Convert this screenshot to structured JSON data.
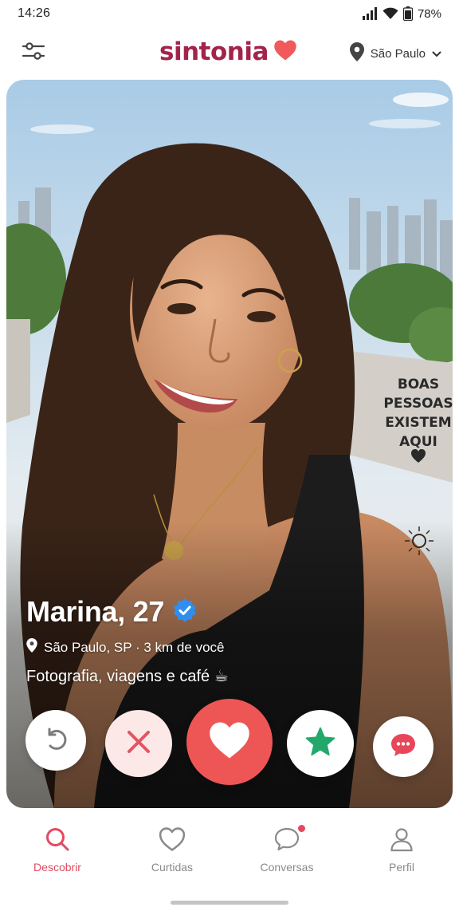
{
  "status_bar": {
    "time": "14:26",
    "battery": "78%"
  },
  "header": {
    "brand": "sintonia",
    "location": "São Paulo"
  },
  "profile": {
    "name": "Marina, 27",
    "verified": true,
    "location": "São Paulo, SP · 3 km de você",
    "bio": "Fotografia, viagens e café ☕"
  },
  "photo_text": [
    "BOAS",
    "PESSOAS",
    "EXISTEM",
    "AQUI"
  ],
  "actions": [
    {
      "id": "undo",
      "icon": "undo-icon"
    },
    {
      "id": "nope",
      "icon": "close-icon",
      "color": "#e25563"
    },
    {
      "id": "like",
      "icon": "heart-icon",
      "color": "#ee5656"
    },
    {
      "id": "super_like",
      "icon": "star-icon",
      "color": "#23a86b"
    },
    {
      "id": "message",
      "icon": "chat-bubble-icon",
      "color": "#e8475b"
    }
  ],
  "nav": {
    "discover": "Descobrir",
    "likes": "Curtidas",
    "chats": "Conversas",
    "profile": "Perfil"
  },
  "colors": {
    "brand": "#a3244a",
    "accent": "#e8475b",
    "like": "#ee5656",
    "super_like": "#23a86b"
  }
}
